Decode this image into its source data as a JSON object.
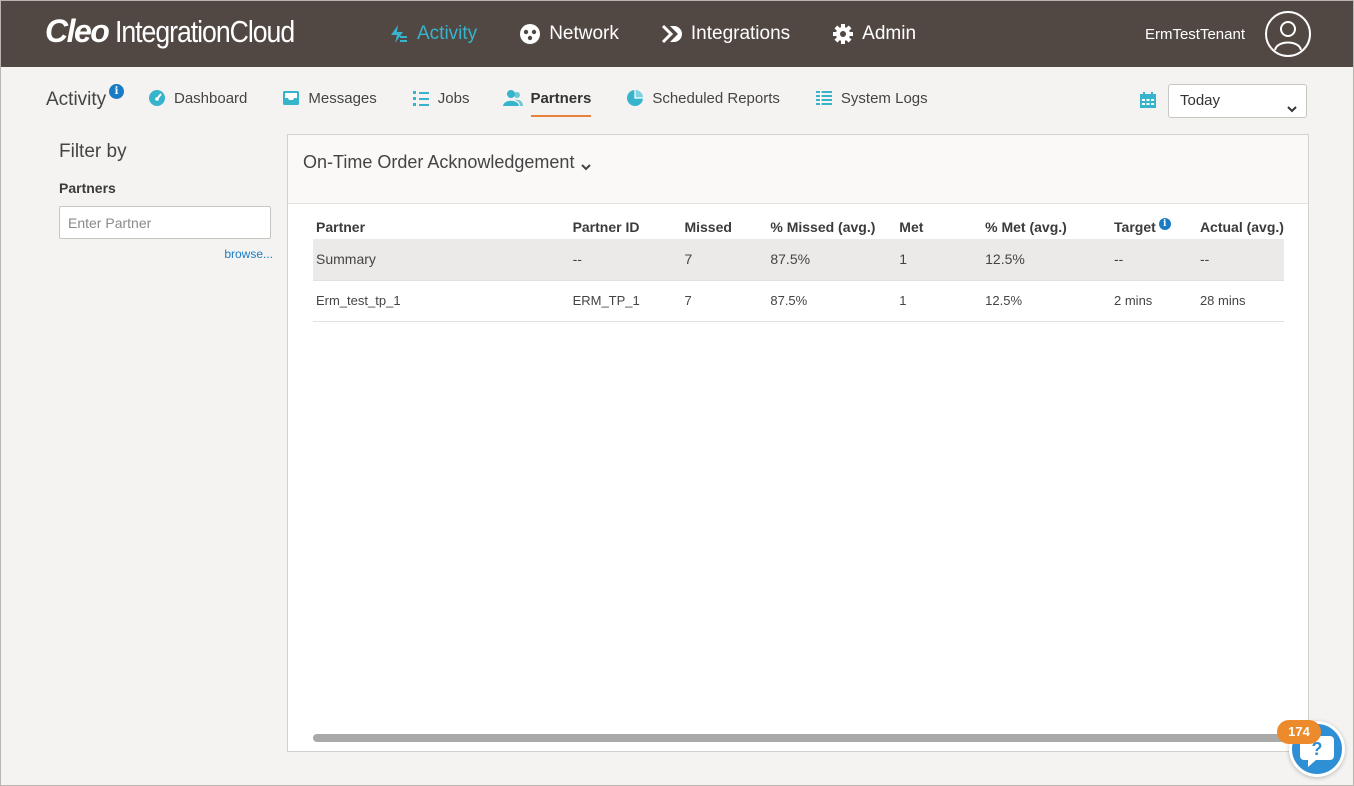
{
  "app": {
    "logo_brand": "Cleo",
    "logo_product": "IntegrationCloud"
  },
  "main_nav": [
    {
      "label": "Activity",
      "icon": "activity-icon",
      "active": true
    },
    {
      "label": "Network",
      "icon": "network-icon",
      "active": false
    },
    {
      "label": "Integrations",
      "icon": "integrations-icon",
      "active": false
    },
    {
      "label": "Admin",
      "icon": "gear-icon",
      "active": false
    }
  ],
  "user": {
    "tenant": "ErmTestTenant",
    "icon": "user-avatar-icon"
  },
  "subnav": {
    "section_title": "Activity",
    "info_glyph": "i",
    "tabs": [
      {
        "label": "Dashboard",
        "icon": "dashboard-icon",
        "active": false
      },
      {
        "label": "Messages",
        "icon": "messages-icon",
        "active": false
      },
      {
        "label": "Jobs",
        "icon": "jobs-icon",
        "active": false
      },
      {
        "label": "Partners",
        "icon": "partners-icon",
        "active": true
      },
      {
        "label": "Scheduled Reports",
        "icon": "pie-chart-icon",
        "active": false
      },
      {
        "label": "System Logs",
        "icon": "system-logs-icon",
        "active": false
      }
    ],
    "date_range": {
      "selected": "Today",
      "icon": "calendar-icon"
    }
  },
  "filter": {
    "title": "Filter by",
    "partners_label": "Partners",
    "partner_placeholder": "Enter Partner",
    "partner_value": "",
    "browse_label": "browse..."
  },
  "report": {
    "title": "On-Time Order Acknowledgement",
    "columns": [
      "Partner",
      "Partner ID",
      "Missed",
      "% Missed (avg.)",
      "Met",
      "% Met (avg.)",
      "Target",
      "Actual (avg.)"
    ],
    "target_info_glyph": "i",
    "rows": [
      {
        "partner": "Summary",
        "partner_id": "--",
        "missed": "7",
        "missed_pct": "87.5%",
        "met": "1",
        "met_pct": "12.5%",
        "target": "--",
        "actual": "--"
      },
      {
        "partner": "Erm_test_tp_1",
        "partner_id": "ERM_TP_1",
        "missed": "7",
        "missed_pct": "87.5%",
        "met": "1",
        "met_pct": "12.5%",
        "target": "2 mins",
        "actual": "28 mins"
      }
    ]
  },
  "help": {
    "badge_count": "174",
    "icon": "help-question-icon"
  },
  "colors": {
    "topbar": "#524843",
    "accent": "#35b4cc",
    "active_tab_underline": "#e8823a",
    "link": "#1a7bc5",
    "badge": "#ec8a2c"
  }
}
